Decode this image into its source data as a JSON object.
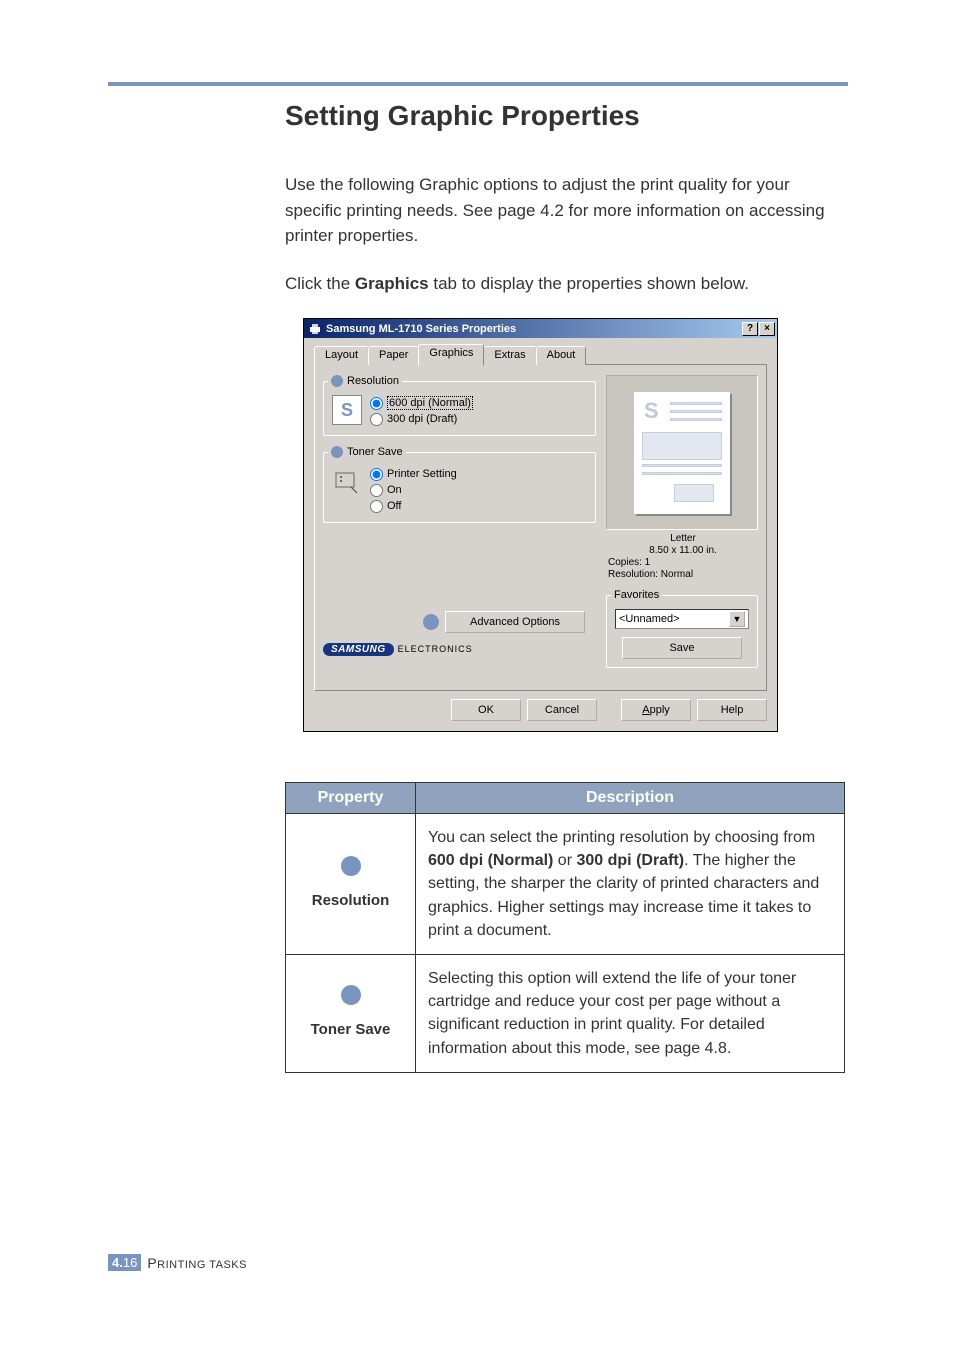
{
  "heading": "Setting Graphic Properties",
  "intro": "Use the following Graphic options to adjust the print quality for your specific printing needs. See page 4.2 for more information on accessing printer properties.",
  "click_line_prefix": "Click the ",
  "click_line_bold": "Graphics",
  "click_line_suffix": " tab to display the properties shown below.",
  "dialog": {
    "title": "Samsung ML-1710 Series Properties",
    "help_btn": "?",
    "close_btn": "×",
    "tabs": {
      "layout": "Layout",
      "paper": "Paper",
      "graphics": "Graphics",
      "extras": "Extras",
      "about": "About"
    },
    "resolution": {
      "legend": "Resolution",
      "opt600": "600 dpi (Normal)",
      "opt300": "300 dpi (Draft)"
    },
    "toner": {
      "legend": "Toner Save",
      "opt_ps": "Printer Setting",
      "opt_on": "On",
      "opt_off": "Off"
    },
    "advanced_btn": "Advanced Options",
    "brand": "SAMSUNG",
    "brand_sub": "ELECTRONICS",
    "preview": {
      "paper": "Letter",
      "dims": "8.50 x 11.00 in.",
      "copies": "Copies: 1",
      "res": "Resolution: Normal"
    },
    "favorites": {
      "legend": "Favorites",
      "selected": "<Unnamed>",
      "save": "Save"
    },
    "footer": {
      "ok": "OK",
      "cancel": "Cancel",
      "apply_u": "A",
      "apply_rest": "pply",
      "help": "Help"
    }
  },
  "table": {
    "h1": "Property",
    "h2": "Description",
    "rows": [
      {
        "name": "Resolution",
        "desc_pre": "You can select the printing resolution by choosing from ",
        "desc_b1": "600 dpi (Normal)",
        "desc_mid1": " or ",
        "desc_b2": "300 dpi (Draft)",
        "desc_post": ". The higher the setting, the sharper the clarity of printed characters and graphics. Higher settings may increase time it takes to print a document."
      },
      {
        "name": "Toner Save",
        "desc_full": "Selecting this option will extend the life of your toner cartridge and reduce your cost per page without a significant reduction in print quality. For detailed information about this mode, see page 4.8."
      }
    ]
  },
  "footer": {
    "chapter": "4.",
    "page": "16",
    "section_first": "P",
    "section_rest": "RINTING TASKS"
  }
}
